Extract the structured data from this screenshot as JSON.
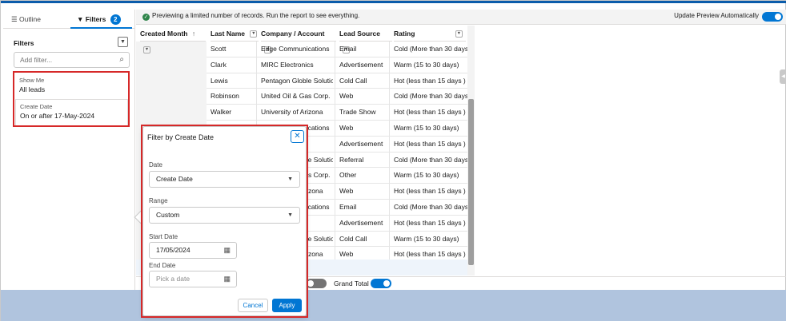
{
  "sidebar": {
    "tabs": [
      {
        "label": "Outline",
        "icon": "list-icon"
      },
      {
        "label": "Filters",
        "icon": "filter-icon",
        "count": "2"
      }
    ],
    "filters_heading": "Filters",
    "add_filter_placeholder": "Add filter...",
    "show_me": {
      "label": "Show Me",
      "value": "All leads"
    },
    "create_date": {
      "label": "Create Date",
      "value": "On or after 17-May-2024"
    }
  },
  "preview": {
    "message": "Previewing a limited number of records. Run the report to see everything.",
    "update_label": "Update Preview Automatically",
    "update_on": true
  },
  "table": {
    "headers": [
      "Created Month",
      "Last Name",
      "Company / Account",
      "Lead Source",
      "Rating"
    ],
    "rows": [
      [
        "Scott",
        "Edge Communications",
        "Email",
        "Cold (More than 30 days)"
      ],
      [
        "Clark",
        "MIRC Electronics",
        "Advertisement",
        "Warm (15 to 30 days)"
      ],
      [
        "Lewis",
        "Pentagon Globle Solution",
        "Cold Call",
        "Hot (less than 15 days )"
      ],
      [
        "Robinson",
        "United Oil & Gas Corp.",
        "Web",
        "Cold (More than 30 days)"
      ],
      [
        "Walker",
        "University of Arizona",
        "Trade Show",
        "Hot (less than 15 days )"
      ],
      [
        "Walker",
        "Edge Communications",
        "Web",
        "Warm (15 to 30 days)"
      ],
      [
        "",
        "",
        "Advertisement",
        "Hot (less than 15 days )"
      ],
      [
        "",
        "Pentagon Globle Solution",
        "Referral",
        "Cold (More than 30 days)"
      ],
      [
        "",
        "United Oil & Gas Corp.",
        "Other",
        "Warm (15 to 30 days)"
      ],
      [
        "",
        "University of Arizona",
        "Web",
        "Hot (less than 15 days )"
      ],
      [
        "",
        "Edge Communications",
        "Email",
        "Cold (More than 30 days)"
      ],
      [
        "",
        "",
        "Advertisement",
        "Hot (less than 15 days )"
      ],
      [
        "",
        "Pentagon Globle Solution",
        "Cold Call",
        "Warm (15 to 30 days)"
      ],
      [
        "",
        "University of Arizona",
        "Web",
        "Hot (less than 15 days )"
      ]
    ]
  },
  "footer": {
    "grand_total_label": "Grand Total",
    "grand_total_on": true,
    "other_toggle_on": false
  },
  "popover": {
    "title": "Filter by Create Date",
    "close_icon": "close-icon",
    "date_label": "Date",
    "date_value": "Create Date",
    "range_label": "Range",
    "range_value": "Custom",
    "start_label": "Start Date",
    "start_value": "17/05/2024",
    "end_label": "End Date",
    "end_placeholder": "Pick a date",
    "cancel_label": "Cancel",
    "apply_label": "Apply"
  },
  "colors": {
    "brand": "#0176d3",
    "highlight_outline": "#d62828",
    "success": "#2e844a"
  }
}
